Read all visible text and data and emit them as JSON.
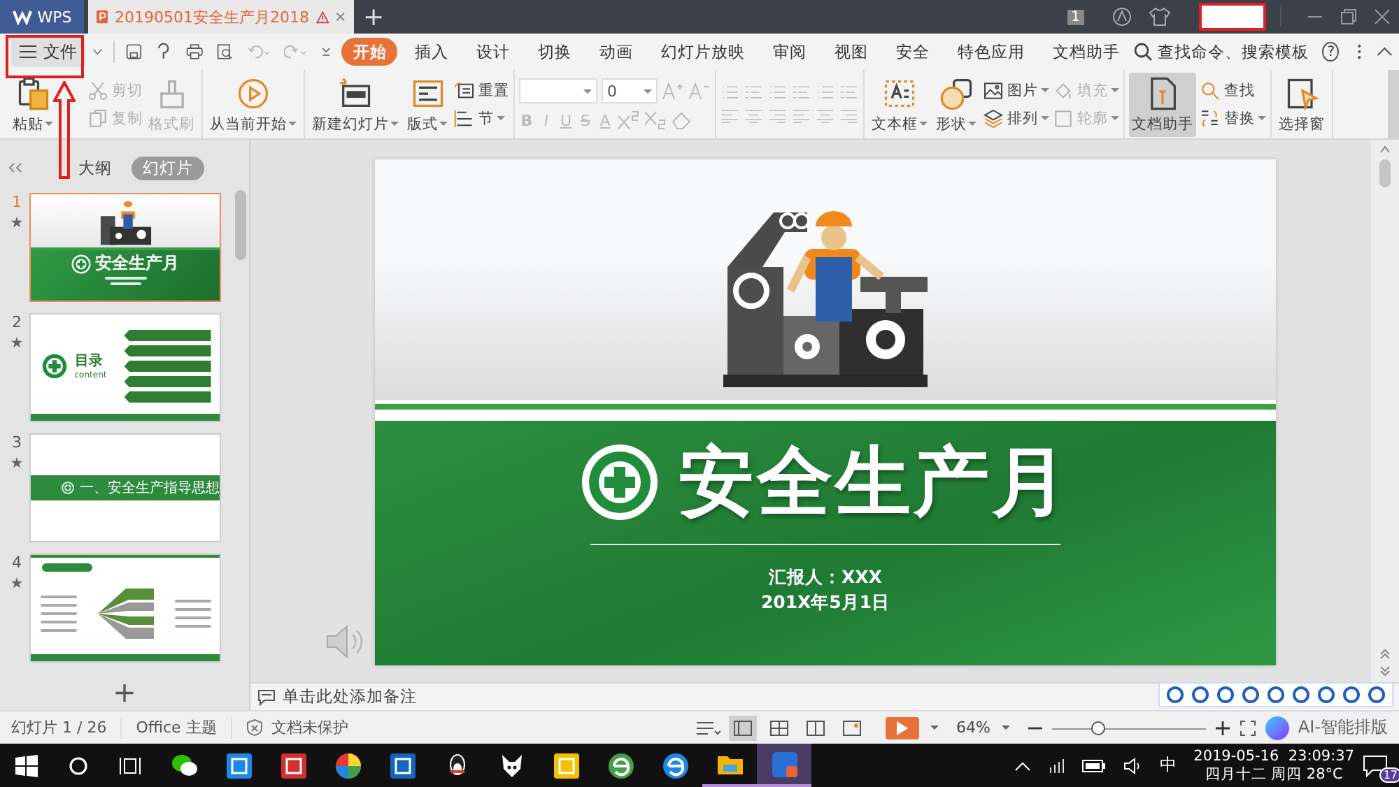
{
  "title_bar": {
    "app_tab": "WPS",
    "doc_tab": {
      "title": "20190501安全生产月2018",
      "selected": true
    },
    "new_tab": "+",
    "account_badge": "1"
  },
  "menu": {
    "file": "文件",
    "tabs": [
      {
        "label": "开始",
        "selected": true
      },
      {
        "label": "插入",
        "selected": false
      },
      {
        "label": "设计",
        "selected": false
      },
      {
        "label": "切换",
        "selected": false
      },
      {
        "label": "动画",
        "selected": false
      },
      {
        "label": "幻灯片放映",
        "selected": false
      },
      {
        "label": "审阅",
        "selected": false
      },
      {
        "label": "视图",
        "selected": false
      },
      {
        "label": "安全",
        "selected": false
      },
      {
        "label": "特色应用",
        "selected": false
      },
      {
        "label": "文档助手",
        "selected": false
      }
    ],
    "search": "查找命令、搜索模板",
    "help": "?"
  },
  "ribbon": [
    {
      "kind": "buttons",
      "items": [
        {
          "kind": "large",
          "label": "粘贴",
          "dropdown": true,
          "disabled": false,
          "pressed": false
        },
        {
          "kind": "stack",
          "items": [
            {
              "label": "剪切",
              "dropdown": false,
              "disabled": true
            },
            {
              "label": "复制",
              "dropdown": false,
              "disabled": true
            }
          ]
        },
        {
          "kind": "large",
          "label": "格式刷",
          "dropdown": false,
          "disabled": true,
          "pressed": false
        }
      ]
    },
    {
      "kind": "buttons",
      "items": [
        {
          "kind": "large",
          "label": "从当前开始",
          "dropdown": true,
          "disabled": false,
          "pressed": false
        }
      ]
    },
    {
      "kind": "buttons",
      "items": [
        {
          "kind": "large",
          "label": "新建幻灯片",
          "dropdown": true,
          "disabled": false,
          "pressed": false
        },
        {
          "kind": "large",
          "label": "版式",
          "dropdown": true,
          "disabled": false,
          "pressed": false
        },
        {
          "kind": "stack",
          "items": [
            {
              "label": "重置",
              "dropdown": false,
              "disabled": false
            },
            {
              "label": "节",
              "dropdown": true,
              "disabled": false
            }
          ]
        }
      ]
    },
    {
      "kind": "font",
      "font_size": "0",
      "styles": [
        "B",
        "I",
        "U",
        "S",
        "A"
      ],
      "disabled": true
    },
    {
      "kind": "paragraph",
      "disabled": true
    },
    {
      "kind": "buttons",
      "items": [
        {
          "kind": "large",
          "label": "文本框",
          "dropdown": true,
          "disabled": false,
          "pressed": false
        },
        {
          "kind": "large",
          "label": "形状",
          "dropdown": true,
          "disabled": false,
          "pressed": false
        },
        {
          "kind": "stack",
          "items": [
            {
              "label": "图片",
              "dropdown": true,
              "disabled": false
            },
            {
              "label": "排列",
              "dropdown": true,
              "disabled": false
            }
          ]
        },
        {
          "kind": "stack",
          "items": [
            {
              "label": "填充",
              "dropdown": true,
              "disabled": true
            },
            {
              "label": "轮廓",
              "dropdown": true,
              "disabled": true
            }
          ]
        }
      ]
    },
    {
      "kind": "buttons",
      "items": [
        {
          "kind": "large",
          "label": "文档助手",
          "dropdown": false,
          "disabled": false,
          "pressed": true
        },
        {
          "kind": "stack",
          "items": [
            {
              "label": "查找",
              "dropdown": false,
              "disabled": false
            },
            {
              "label": "替换",
              "dropdown": true,
              "disabled": false
            }
          ]
        }
      ]
    },
    {
      "kind": "buttons",
      "items": [
        {
          "kind": "large",
          "label": "选择窗",
          "dropdown": false,
          "disabled": false,
          "pressed": false
        }
      ]
    }
  ],
  "sidebar": {
    "view_tabs": [
      {
        "label": "大纲",
        "selected": false
      },
      {
        "label": "幻灯片",
        "selected": true
      }
    ],
    "slides": [
      {
        "number": "1",
        "kind": "title",
        "title": "安全生产月",
        "selected": true
      },
      {
        "number": "2",
        "kind": "contents",
        "title": "目录",
        "subtitle": "content",
        "selected": false
      },
      {
        "number": "3",
        "kind": "section",
        "title": "一、安全生产指导思想",
        "selected": false
      },
      {
        "number": "4",
        "kind": "content",
        "selected": false
      }
    ],
    "add": "+"
  },
  "slide": {
    "title": "安全生产月",
    "reporter": "汇报人：XXX",
    "date": "201X年5月1日"
  },
  "notes": {
    "placeholder": "单击此处添加备注"
  },
  "status_bar": {
    "slide_counter": "幻灯片 1 / 26",
    "theme": "Office 主题",
    "protection": "文档未保护",
    "views": [
      {
        "selected": true
      },
      {
        "selected": false
      },
      {
        "selected": false
      },
      {
        "selected": false
      }
    ],
    "zoom": {
      "reading": "64%",
      "level": 0.3
    },
    "ai_layout": "AI-智能排版"
  },
  "taskbar": {
    "ime": "中",
    "clock_time": "2019-05-16  23:09:37",
    "clock_date": "四月十二 周四 28°C",
    "notification_count": "17"
  }
}
